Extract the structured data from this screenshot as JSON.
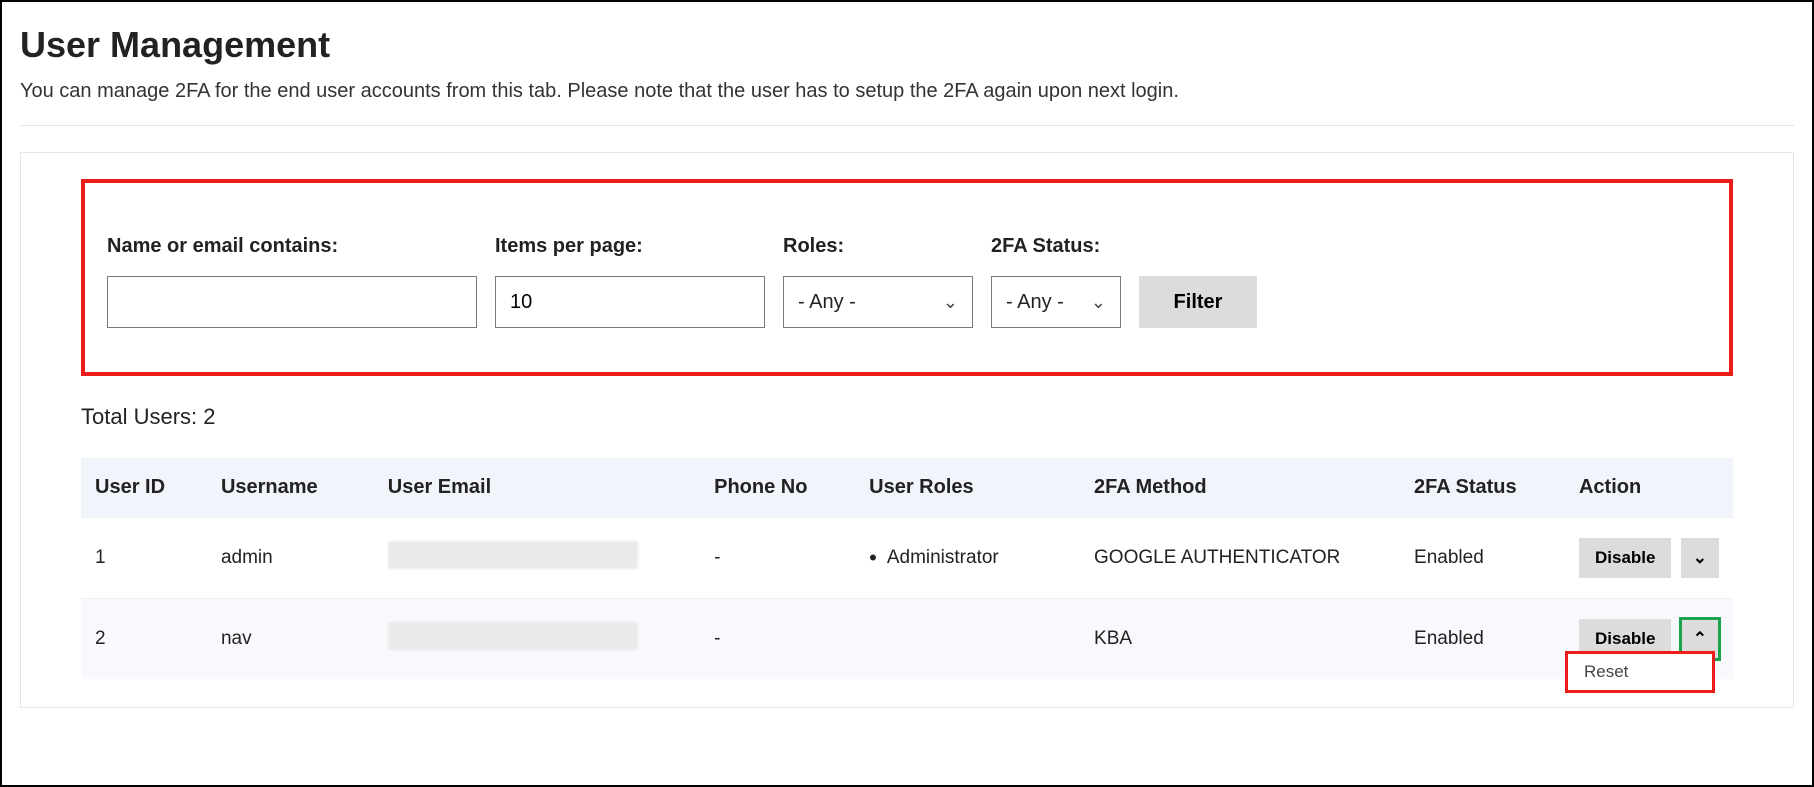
{
  "header": {
    "title": "User Management",
    "description": "You can manage 2FA for the end user accounts from this tab. Please note that the user has to setup the 2FA again upon next login."
  },
  "filters": {
    "name_label": "Name or email contains:",
    "name_value": "",
    "items_label": "Items per page:",
    "items_value": "10",
    "roles_label": "Roles:",
    "roles_value": "- Any -",
    "twofa_label": "2FA Status:",
    "twofa_value": "- Any -",
    "filter_button": "Filter"
  },
  "summary": {
    "total_prefix": "Total Users: ",
    "total_count": "2"
  },
  "table": {
    "headers": {
      "user_id": "User ID",
      "username": "Username",
      "user_email": "User Email",
      "phone": "Phone No",
      "roles": "User Roles",
      "method": "2FA Method",
      "status": "2FA Status",
      "action": "Action"
    },
    "rows": [
      {
        "user_id": "1",
        "username": "admin",
        "phone": "-",
        "role": "Administrator",
        "method": "GOOGLE AUTHENTICATOR",
        "status": "Enabled",
        "action_label": "Disable",
        "caret": "▾",
        "dropdown_open": false
      },
      {
        "user_id": "2",
        "username": "nav",
        "phone": "-",
        "role": "",
        "method": "KBA",
        "status": "Enabled",
        "action_label": "Disable",
        "caret": "▴",
        "dropdown_open": true,
        "dropdown_item": "Reset"
      }
    ]
  },
  "icons": {
    "chevron_down": "⌄",
    "caret_down": "⌄",
    "caret_up": "⌃"
  }
}
